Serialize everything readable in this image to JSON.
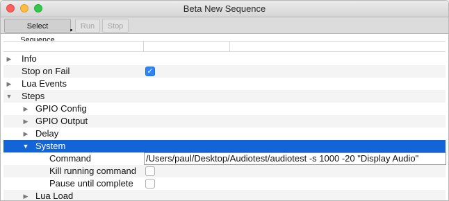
{
  "window": {
    "title": "Beta New Sequence"
  },
  "toolbar": {
    "select_sequence_label": "Select Sequence",
    "run_label": "Run",
    "stop_label": "Stop"
  },
  "tree": {
    "info": "Info",
    "stop_on_fail": "Stop on Fail",
    "lua_events": "Lua Events",
    "steps": "Steps",
    "gpio_config": "GPIO Config",
    "gpio_output": "GPIO Output",
    "delay": "Delay",
    "system": "System",
    "command": "Command",
    "command_value": "/Users/paul/Desktop/Audiotest/audiotest -s 1000 -20 \"Display Audio\"",
    "kill_running_command": "Kill running command",
    "pause_until_complete": "Pause until complete",
    "lua_load": "Lua Load"
  },
  "icons": {
    "collapsed": "▶",
    "expanded": "▼",
    "checkmark": "✓"
  },
  "colors": {
    "selection": "#1264d7",
    "checkbox_on": "#2d86f7"
  }
}
